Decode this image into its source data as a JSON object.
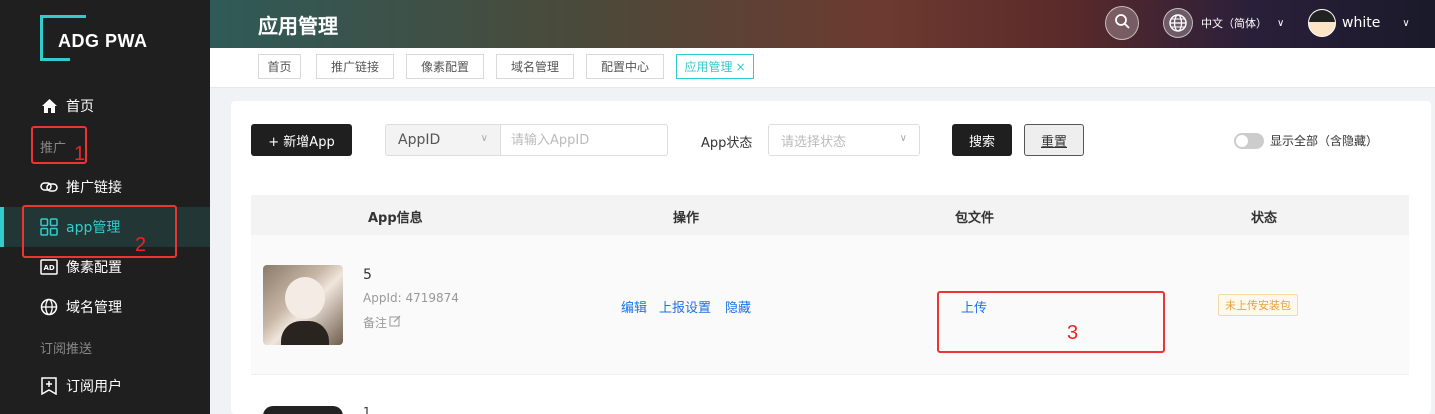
{
  "sidebar": {
    "logo_text": "ADG PWA",
    "group_promo": "推广",
    "group_subscribe": "订阅推送",
    "items": [
      {
        "label": "首页",
        "icon": "home-icon"
      },
      {
        "label": "推广链接",
        "icon": "link-icon"
      },
      {
        "label": "app管理",
        "icon": "grid-icon",
        "active": true
      },
      {
        "label": "像素配置",
        "icon": "ad-icon"
      },
      {
        "label": "域名管理",
        "icon": "globe-icon"
      },
      {
        "label": "订阅用户",
        "icon": "subscriber-icon"
      }
    ]
  },
  "header": {
    "title": "应用管理",
    "language": "中文（简体）",
    "username": "white"
  },
  "tabs": [
    {
      "label": "首页"
    },
    {
      "label": "推广链接"
    },
    {
      "label": "像素配置"
    },
    {
      "label": "域名管理"
    },
    {
      "label": "配置中心"
    },
    {
      "label": "应用管理",
      "active": true,
      "close": "×"
    }
  ],
  "toolbar": {
    "add_label": "+ 新增App",
    "appid_select": "AppID",
    "appid_placeholder": "请输入AppID",
    "status_label": "App状态",
    "status_placeholder": "请选择状态",
    "search_label": "搜索",
    "reset_label": "重置",
    "show_all_label": "显示全部（含隐藏）",
    "show_all_on": false
  },
  "table": {
    "columns": [
      "App信息",
      "操作",
      "包文件",
      "状态"
    ],
    "rows": [
      {
        "name": "5",
        "app_id": "AppId: 4719874",
        "note": "备注",
        "actions": [
          "编辑",
          "上报设置",
          "隐藏"
        ],
        "package": "上传",
        "status": "未上传安装包"
      }
    ],
    "next_row_name": "1"
  },
  "annotations": [
    "1",
    "2",
    "3"
  ],
  "colors": {
    "accent": "#33cccc",
    "sidebar_bg": "#1f1f1f",
    "link": "#1a73e8",
    "annotation": "#ee3333",
    "badge_text": "#e6a23c"
  }
}
